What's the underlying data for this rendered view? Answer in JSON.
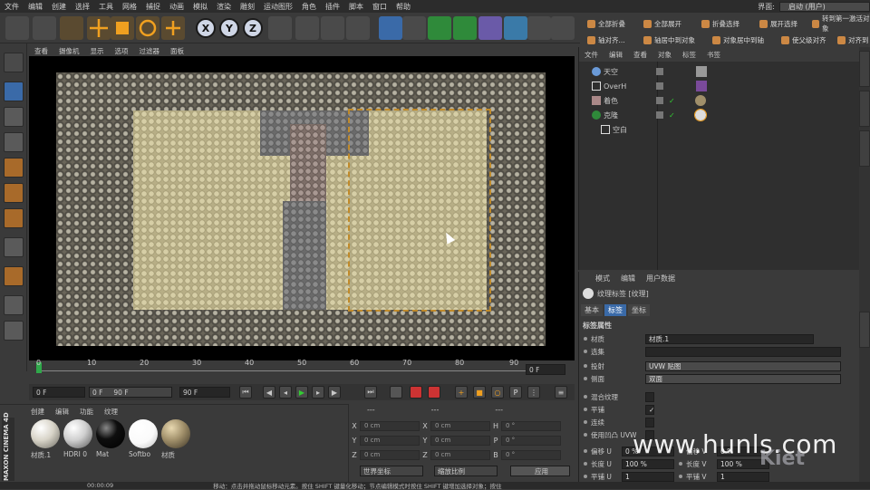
{
  "menubar": {
    "items": [
      "文件",
      "编辑",
      "创建",
      "选择",
      "工具",
      "网格",
      "捕捉",
      "动画",
      "模拟",
      "渲染",
      "雕刻",
      "运动图形",
      "角色",
      "插件",
      "脚本",
      "窗口",
      "帮助"
    ],
    "layout_label": "界面:",
    "layout_value": "启动 (用户)"
  },
  "viewport_menu": [
    "查看",
    "摄像机",
    "显示",
    "选项",
    "过滤器",
    "面板"
  ],
  "object_manager": {
    "top_buttons": [
      "全部折叠",
      "全部展开",
      "折叠选择",
      "展开选择",
      "转到第一激活对象"
    ],
    "top_buttons_row2": [
      "轴对齐...",
      "轴居中到对象",
      "对象居中到轴",
      "使父级对齐",
      "对齐到"
    ],
    "menu": [
      "文件",
      "编辑",
      "查看",
      "对象",
      "标签",
      "书签"
    ],
    "objects": [
      {
        "name": "天空"
      },
      {
        "name": "OverH"
      },
      {
        "name": "着色"
      },
      {
        "name": "克隆"
      },
      {
        "name": "空白"
      }
    ]
  },
  "attributes": {
    "menu": [
      "模式",
      "编辑",
      "用户数据"
    ],
    "title": "纹理标签 [纹理]",
    "tabs": [
      "基本",
      "标签",
      "坐标"
    ],
    "section": "标签属性",
    "rows": [
      {
        "label": "材质",
        "value": "材质.1"
      },
      {
        "label": "选集",
        "value": ""
      },
      {
        "label": "投射",
        "value": "UVW 贴图"
      },
      {
        "label": "侧面",
        "value": "双面"
      },
      {
        "label": "混合纹理",
        "value": ""
      },
      {
        "label": "平铺",
        "value": "✓"
      },
      {
        "label": "连续",
        "value": ""
      },
      {
        "label": "使用凹凸 UVW",
        "value": ""
      }
    ],
    "uv_rows": [
      {
        "l1": "偏移 U",
        "v1": "0 %",
        "l2": "偏移 V",
        "v2": "0 %"
      },
      {
        "l1": "长度 U",
        "v1": "100 %",
        "l2": "长度 V",
        "v2": "100 %"
      },
      {
        "l1": "平铺 U",
        "v1": "1",
        "l2": "平铺 V",
        "v2": "1"
      }
    ]
  },
  "timeline": {
    "ticks": [
      "0",
      "10",
      "20",
      "30",
      "40",
      "50",
      "60",
      "70",
      "80",
      "90"
    ],
    "current_frame": "0 F",
    "start": "0 F",
    "range_start": "0 F",
    "range_end": "90 F",
    "end": "90 F"
  },
  "materials": {
    "menu": [
      "创建",
      "编辑",
      "功能",
      "纹理"
    ],
    "items": [
      {
        "name": "材质.1",
        "color": "#d8d4c8"
      },
      {
        "name": "HDRI 0",
        "color": "#cfcfcf"
      },
      {
        "name": "Mat",
        "color": "#0e0e0e"
      },
      {
        "name": "Softbo",
        "color": "#fafafa"
      },
      {
        "name": "材质",
        "color": "#a08f6a"
      }
    ]
  },
  "coords": {
    "header": [
      "---",
      "---",
      "---"
    ],
    "rows": [
      {
        "a": "X",
        "av": "0 cm",
        "b": "X",
        "bv": "0 cm",
        "c": "H",
        "cv": "0 °"
      },
      {
        "a": "Y",
        "av": "0 cm",
        "b": "Y",
        "bv": "0 cm",
        "c": "P",
        "cv": "0 °"
      },
      {
        "a": "Z",
        "av": "0 cm",
        "b": "Z",
        "bv": "0 cm",
        "c": "B",
        "cv": "0 °"
      }
    ],
    "mode_world": "世界坐标",
    "mode_scale": "缩放比例",
    "apply": "应用"
  },
  "status": {
    "time": "00:00:09",
    "hint": "移动：点击并拖动鼠标移动元素。按住 SHIFT 键量化移动；节点编辑模式时按住 SHIFT 键增加选择对象；按住"
  },
  "watermark": "www.hunls.com",
  "watermark2": "Kiet",
  "brand": "MAXON CINEMA 4D",
  "toolbar_axis": [
    "X",
    "Y",
    "Z"
  ]
}
